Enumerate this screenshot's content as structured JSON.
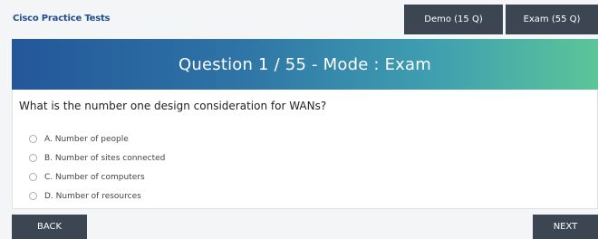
{
  "header": {
    "brand": "Cisco Practice Tests",
    "demo_label": "Demo (15 Q)",
    "exam_label": "Exam (55 Q)"
  },
  "banner": {
    "title": "Question 1 / 55 - Mode : Exam"
  },
  "question": {
    "text": "What is the number one design consideration for WANs?",
    "options": [
      {
        "label": "A. Number of people"
      },
      {
        "label": "B. Number of sites connected"
      },
      {
        "label": "C. Number of computers"
      },
      {
        "label": "D. Number of resources"
      }
    ]
  },
  "nav": {
    "back_label": "BACK",
    "next_label": "NEXT"
  }
}
